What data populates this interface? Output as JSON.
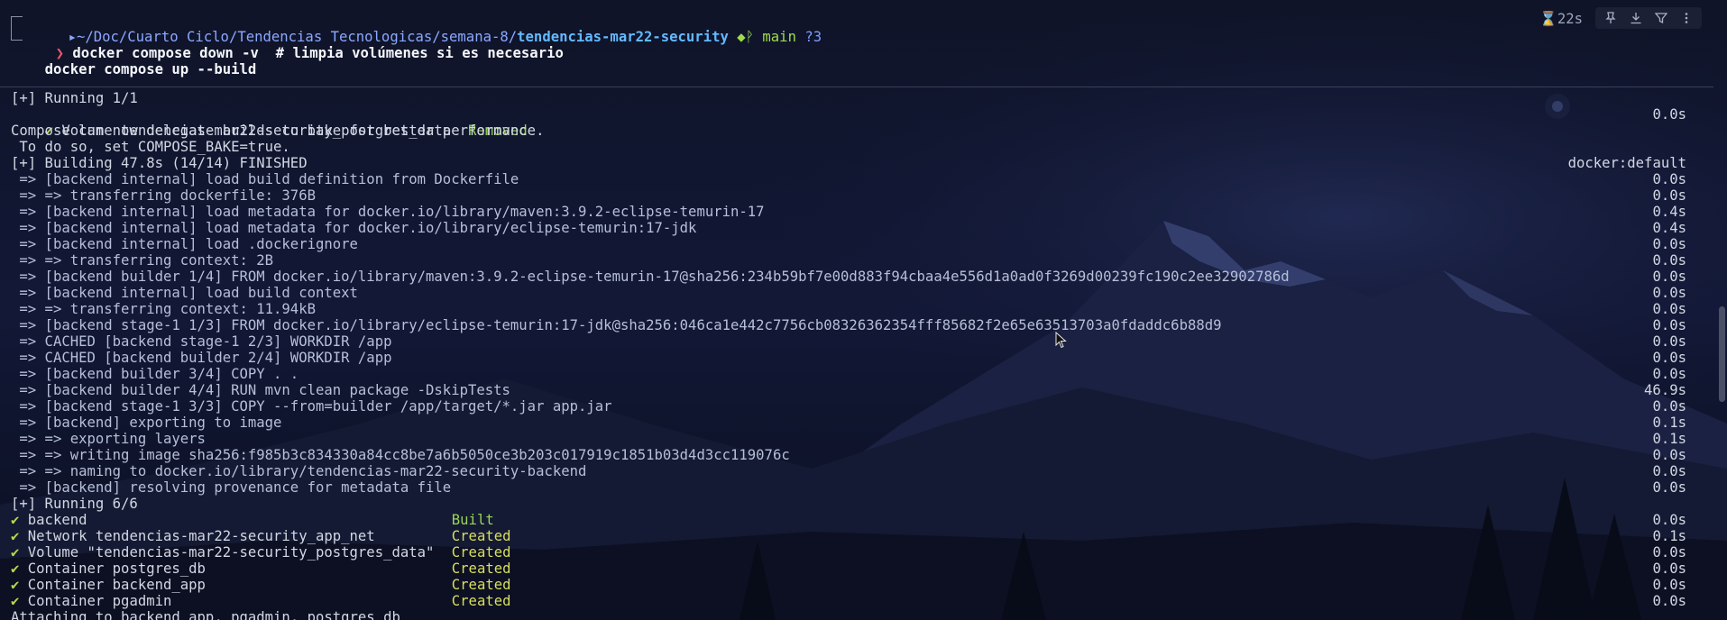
{
  "prompt": {
    "os_glyph": "",
    "folder_glyph": "📂",
    "path_prefix": "~/Doc/Cuarto Ciclo/Tendencias Tecnologicas/semana-8/",
    "path_current": "tendencias-mar22-security",
    "git_glyph": "🐱",
    "branch_glyph": "ᚹ",
    "branch": "main",
    "status": "?3",
    "arrow": "❯"
  },
  "duration": "⌛22s",
  "commands": [
    "docker compose down -v  # limpia volúmenes si es necesario",
    "docker compose up --build"
  ],
  "output": {
    "running_1": "[+] Running 1/1",
    "volume_removed": {
      "check": "✔",
      "name": "Volume tendencias-mar22-security_postgres_data",
      "status": "Removed",
      "time": "0.0s"
    },
    "bake_1": "Compose can now delegate builds to bake for better performance.",
    "bake_2": " To do so, set COMPOSE_BAKE=true.",
    "building": "[+] Building 47.8s (14/14) FINISHED",
    "builder_name": "docker:default",
    "build_steps": [
      {
        "text": " => [backend internal] load build definition from Dockerfile",
        "time": "0.0s"
      },
      {
        "text": " => => transferring dockerfile: 376B",
        "time": "0.0s"
      },
      {
        "text": " => [backend internal] load metadata for docker.io/library/maven:3.9.2-eclipse-temurin-17",
        "time": "0.4s"
      },
      {
        "text": " => [backend internal] load metadata for docker.io/library/eclipse-temurin:17-jdk",
        "time": "0.4s"
      },
      {
        "text": " => [backend internal] load .dockerignore",
        "time": "0.0s"
      },
      {
        "text": " => => transferring context: 2B",
        "time": "0.0s"
      },
      {
        "text": " => [backend builder 1/4] FROM docker.io/library/maven:3.9.2-eclipse-temurin-17@sha256:234b59bf7e00d883f94cbaa4e556d1a0ad0f3269d00239fc190c2ee32902786d",
        "time": "0.0s"
      },
      {
        "text": " => [backend internal] load build context",
        "time": "0.0s"
      },
      {
        "text": " => => transferring context: 11.94kB",
        "time": "0.0s"
      },
      {
        "text": " => [backend stage-1 1/3] FROM docker.io/library/eclipse-temurin:17-jdk@sha256:046ca1e442c7756cb08326362354fff85682f2e65e63513703a0fdaddc6b88d9",
        "time": "0.0s"
      },
      {
        "text": " => CACHED [backend stage-1 2/3] WORKDIR /app",
        "time": "0.0s"
      },
      {
        "text": " => CACHED [backend builder 2/4] WORKDIR /app",
        "time": "0.0s"
      },
      {
        "text": " => [backend builder 3/4] COPY . .",
        "time": "0.0s"
      },
      {
        "text": " => [backend builder 4/4] RUN mvn clean package -DskipTests",
        "time": "46.9s"
      },
      {
        "text": " => [backend stage-1 3/3] COPY --from=builder /app/target/*.jar app.jar",
        "time": "0.0s"
      },
      {
        "text": " => [backend] exporting to image",
        "time": "0.1s"
      },
      {
        "text": " => => exporting layers",
        "time": "0.1s"
      },
      {
        "text": " => => writing image sha256:f985b3c834330a84cc8be7a6b5050ce3b203c017919c1851b03d4d3cc119076c",
        "time": "0.0s"
      },
      {
        "text": " => => naming to docker.io/library/tendencias-mar22-security-backend",
        "time": "0.0s"
      },
      {
        "text": " => [backend] resolving provenance for metadata file",
        "time": "0.0s"
      }
    ],
    "running_6": "[+] Running 6/6",
    "services": [
      {
        "check": "✔",
        "name": "backend",
        "status": "Built",
        "time": "0.0s"
      },
      {
        "check": "✔",
        "name": "Network tendencias-mar22-security_app_net",
        "status": "Created",
        "time": "0.1s"
      },
      {
        "check": "✔",
        "name": "Volume \"tendencias-mar22-security_postgres_data\"",
        "status": "Created",
        "time": "0.0s"
      },
      {
        "check": "✔",
        "name": "Container postgres_db",
        "status": "Created",
        "time": "0.0s"
      },
      {
        "check": "✔",
        "name": "Container backend_app",
        "status": "Created",
        "time": "0.0s"
      },
      {
        "check": "✔",
        "name": "Container pgadmin",
        "status": "Created",
        "time": "0.0s"
      }
    ],
    "attaching": "Attaching to backend_app, pgadmin, postgres_db"
  },
  "toolbar": {
    "icons": [
      "pin-icon",
      "download-icon",
      "filter-icon",
      "more-icon"
    ]
  },
  "colors": {
    "background": "#0e1224",
    "green_status": "#98d55a",
    "yellow_status": "#d9df5d",
    "prompt_red": "#f2576a",
    "dir_blue": "#63b9ff"
  }
}
